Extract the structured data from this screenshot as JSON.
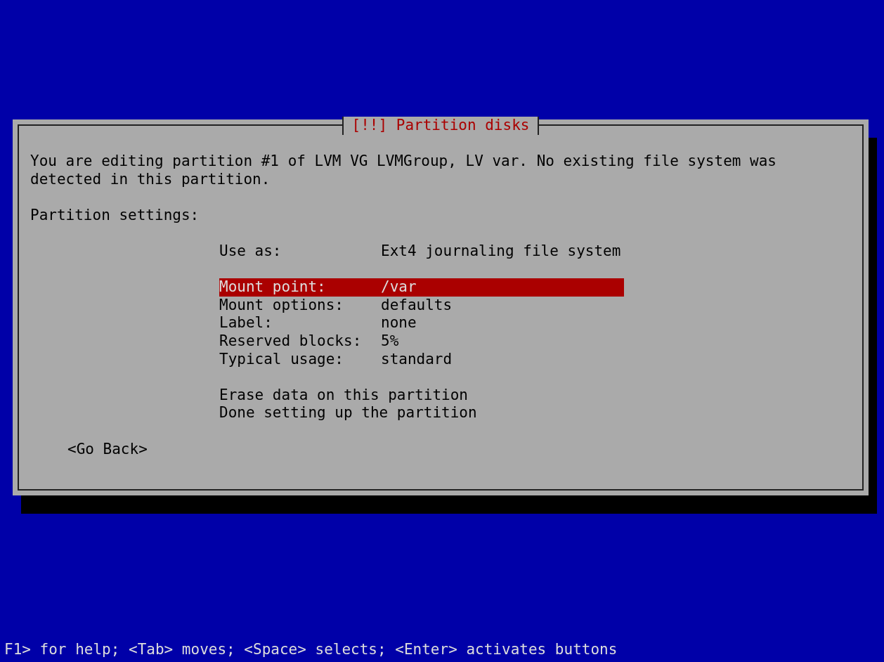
{
  "dialog": {
    "title": "[!!] Partition disks",
    "intro": "You are editing partition #1 of LVM VG LVMGroup, LV var. No existing file system was detected in this partition.",
    "section_label": "Partition settings:",
    "menu": [
      {
        "kind": "setting",
        "label": "Use as:",
        "value": "Ext4 journaling file system",
        "selected": false
      },
      {
        "kind": "spacer"
      },
      {
        "kind": "setting",
        "label": "Mount point:",
        "value": "/var",
        "selected": true
      },
      {
        "kind": "setting",
        "label": "Mount options:",
        "value": "defaults",
        "selected": false
      },
      {
        "kind": "setting",
        "label": "Label:",
        "value": "none",
        "selected": false
      },
      {
        "kind": "setting",
        "label": "Reserved blocks:",
        "value": "5%",
        "selected": false
      },
      {
        "kind": "setting",
        "label": "Typical usage:",
        "value": "standard",
        "selected": false
      },
      {
        "kind": "spacer"
      },
      {
        "kind": "action",
        "label": "Erase data on this partition",
        "selected": false
      },
      {
        "kind": "action",
        "label": "Done setting up the partition",
        "selected": false
      }
    ],
    "button": "<Go Back>"
  },
  "help_line": "F1> for help; <Tab> moves; <Space> selects; <Enter> activates buttons"
}
